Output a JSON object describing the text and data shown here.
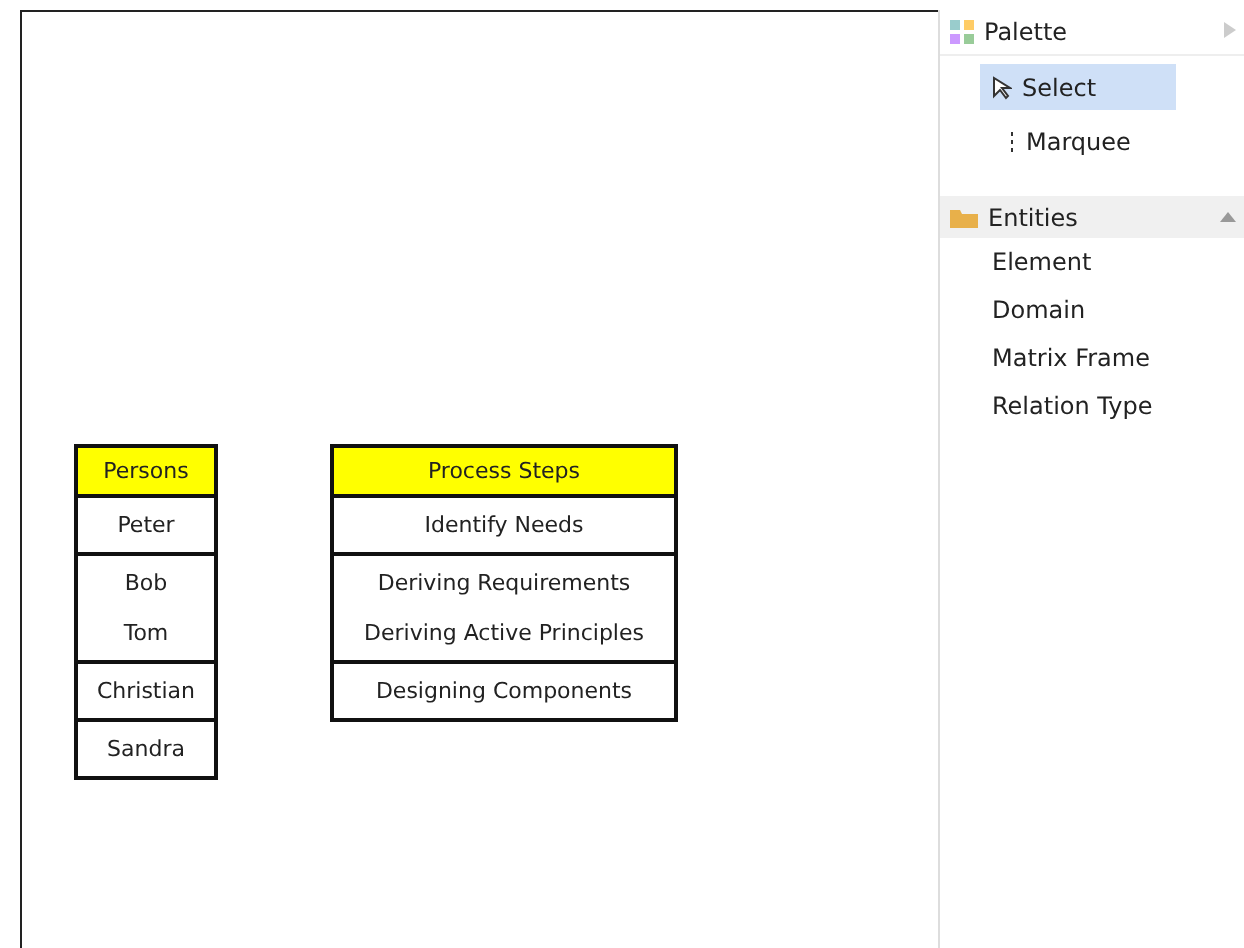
{
  "diagram": {
    "tables": [
      {
        "title": "Persons",
        "cells": [
          [
            "Peter"
          ],
          [
            "Bob",
            "Tom"
          ],
          [
            "Christian"
          ],
          [
            "Sandra"
          ]
        ]
      },
      {
        "title": "Process Steps",
        "cells": [
          [
            "Identify Needs"
          ],
          [
            "Deriving Requirements",
            "Deriving Active Principles"
          ],
          [
            "Designing Components"
          ]
        ]
      }
    ]
  },
  "palette": {
    "title": "Palette",
    "tools": [
      {
        "label": "Select",
        "kind": "select",
        "selected": true
      },
      {
        "label": "Marquee",
        "kind": "marquee",
        "selected": false
      }
    ],
    "drawers": [
      {
        "title": "Entities",
        "expanded": true,
        "items": [
          "Element",
          "Domain",
          "Matrix Frame",
          "Relation Type"
        ]
      }
    ]
  }
}
